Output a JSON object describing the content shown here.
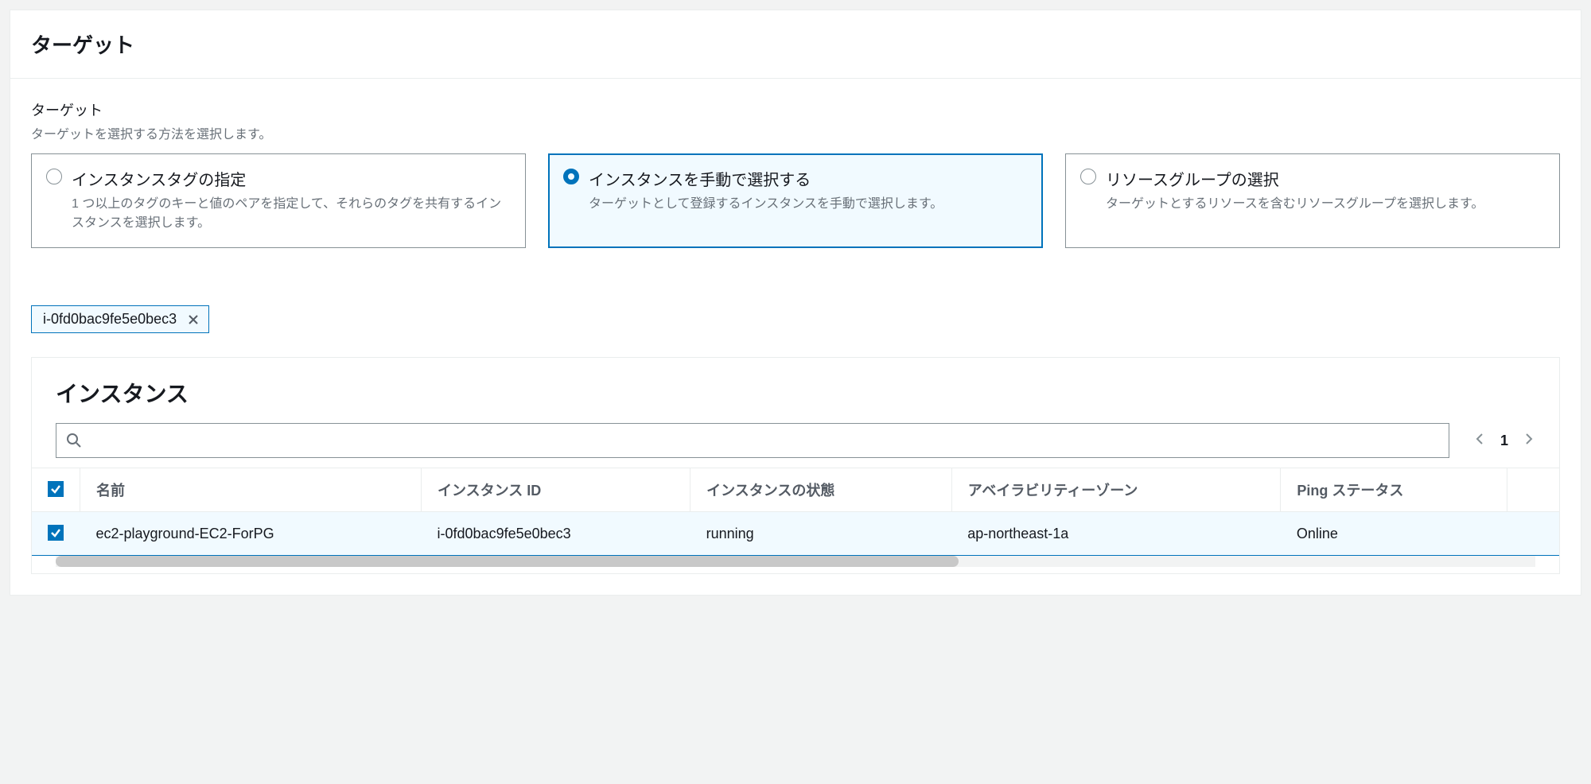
{
  "header": {
    "title": "ターゲット"
  },
  "field": {
    "label": "ターゲット",
    "desc": "ターゲットを選択する方法を選択します。"
  },
  "options": [
    {
      "title": "インスタンスタグの指定",
      "desc": "1 つ以上のタグのキーと値のペアを指定して、それらのタグを共有するインスタンスを選択します。",
      "selected": false
    },
    {
      "title": "インスタンスを手動で選択する",
      "desc": "ターゲットとして登録するインスタンスを手動で選択します。",
      "selected": true
    },
    {
      "title": "リソースグループの選択",
      "desc": "ターゲットとするリソースを含むリソースグループを選択します。",
      "selected": false
    }
  ],
  "token": {
    "label": "i-0fd0bac9fe5e0bec3"
  },
  "instances": {
    "title": "インスタンス",
    "search_placeholder": "",
    "page": "1",
    "columns": [
      "名前",
      "インスタンス ID",
      "インスタンスの状態",
      "アベイラビリティーゾーン",
      "Ping ステータス"
    ],
    "rows": [
      {
        "checked": true,
        "name": "ec2-playground-EC2-ForPG",
        "id": "i-0fd0bac9fe5e0bec3",
        "state": "running",
        "az": "ap-northeast-1a",
        "ping": "Online"
      }
    ]
  }
}
